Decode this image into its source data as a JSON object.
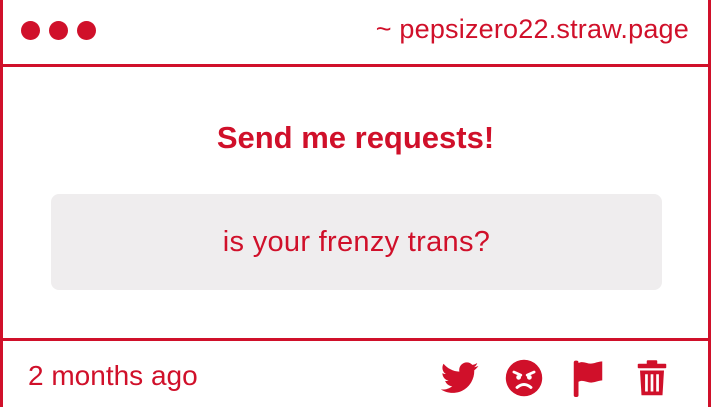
{
  "window": {
    "site_label": "~ pepsizero22.straw.page"
  },
  "main": {
    "heading": "Send me requests!",
    "question": "is your frenzy trans?"
  },
  "footer": {
    "timestamp": "2 months ago",
    "actions": [
      {
        "icon": "twitter-icon"
      },
      {
        "icon": "angry-face-icon"
      },
      {
        "icon": "flag-icon"
      },
      {
        "icon": "trash-icon"
      }
    ]
  },
  "colors": {
    "accent": "#d0102a",
    "question_bg": "#efedee",
    "background": "#ffffff"
  }
}
